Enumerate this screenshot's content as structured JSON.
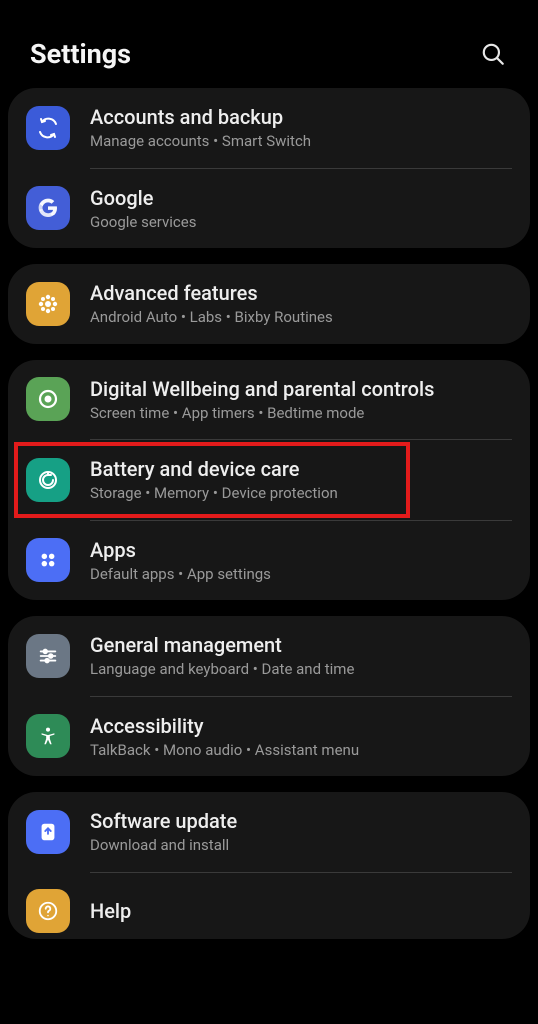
{
  "header": {
    "title": "Settings"
  },
  "groups": [
    {
      "items": [
        {
          "id": "accounts-backup",
          "icon": "sync",
          "iconBg": "#3b5bd9",
          "title": "Accounts and backup",
          "sub": "Manage accounts  •  Smart Switch"
        },
        {
          "id": "google",
          "icon": "google",
          "iconBg": "#435ed7",
          "title": "Google",
          "sub": "Google services"
        }
      ]
    },
    {
      "items": [
        {
          "id": "advanced-features",
          "icon": "gear-flower",
          "iconBg": "#e0a436",
          "title": "Advanced features",
          "sub": "Android Auto  •  Labs  •  Bixby Routines"
        }
      ]
    },
    {
      "items": [
        {
          "id": "digital-wellbeing",
          "icon": "wellbeing",
          "iconBg": "#5aa356",
          "title": "Digital Wellbeing and parental controls",
          "sub": "Screen time  •  App timers  •  Bedtime mode"
        },
        {
          "id": "battery-device-care",
          "icon": "device-care",
          "iconBg": "#16a085",
          "title": "Battery and device care",
          "sub": "Storage  •  Memory  •  Device protection",
          "highlighted": true
        },
        {
          "id": "apps",
          "icon": "apps",
          "iconBg": "#4c6ef5",
          "title": "Apps",
          "sub": "Default apps  •  App settings"
        }
      ]
    },
    {
      "items": [
        {
          "id": "general-management",
          "icon": "sliders",
          "iconBg": "#6b7785",
          "title": "General management",
          "sub": "Language and keyboard  •  Date and time"
        },
        {
          "id": "accessibility",
          "icon": "accessibility",
          "iconBg": "#2e8b57",
          "title": "Accessibility",
          "sub": "TalkBack  •  Mono audio  •  Assistant menu"
        }
      ]
    },
    {
      "items": [
        {
          "id": "software-update",
          "icon": "update",
          "iconBg": "#4c6ef5",
          "title": "Software update",
          "sub": "Download and install"
        },
        {
          "id": "help",
          "icon": "help",
          "iconBg": "#e0a436",
          "title": "Help",
          "sub": ""
        }
      ]
    }
  ]
}
